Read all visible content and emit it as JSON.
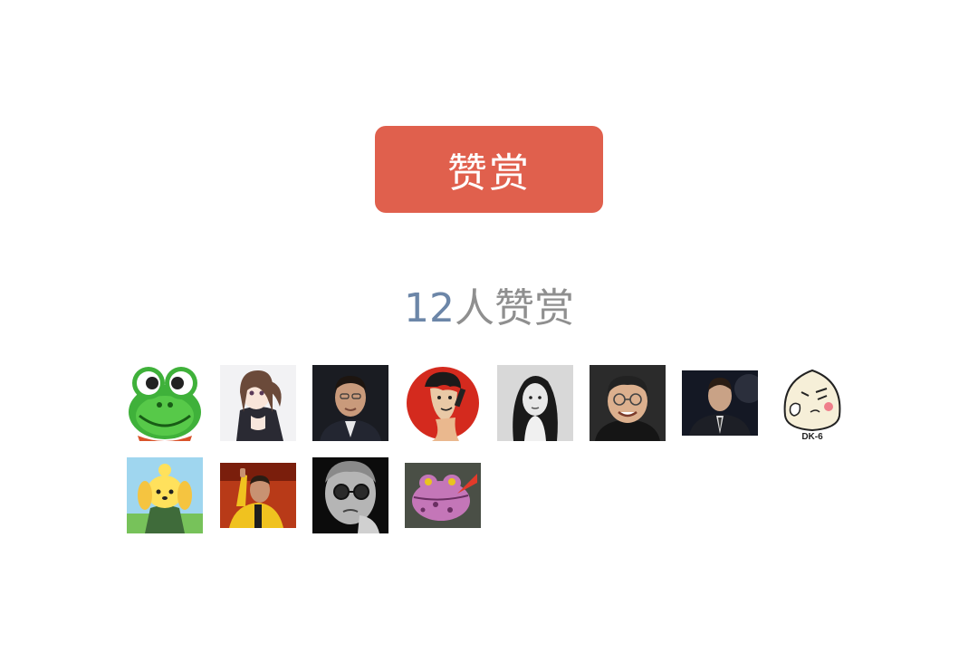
{
  "reward": {
    "button_label": "赞赏",
    "count": "12",
    "count_suffix": "人赞赏"
  },
  "colors": {
    "button_bg": "#e0604d",
    "count_number": "#6c86a8",
    "count_text": "#8f8f8f"
  },
  "avatars": [
    {
      "icon": "frog-cartoon-avatar"
    },
    {
      "icon": "anime-girl-avatar"
    },
    {
      "icon": "man-in-suit-avatar"
    },
    {
      "icon": "red-circle-portrait-avatar"
    },
    {
      "icon": "woman-bw-portrait-avatar"
    },
    {
      "icon": "man-with-glasses-avatar"
    },
    {
      "icon": "man-dark-suit-avatar"
    },
    {
      "icon": "rice-ball-doodle-avatar"
    },
    {
      "icon": "yellow-dog-cartoon-avatar"
    },
    {
      "icon": "man-thumbs-up-avatar"
    },
    {
      "icon": "man-bw-glasses-avatar"
    },
    {
      "icon": "purple-toad-avatar"
    }
  ]
}
